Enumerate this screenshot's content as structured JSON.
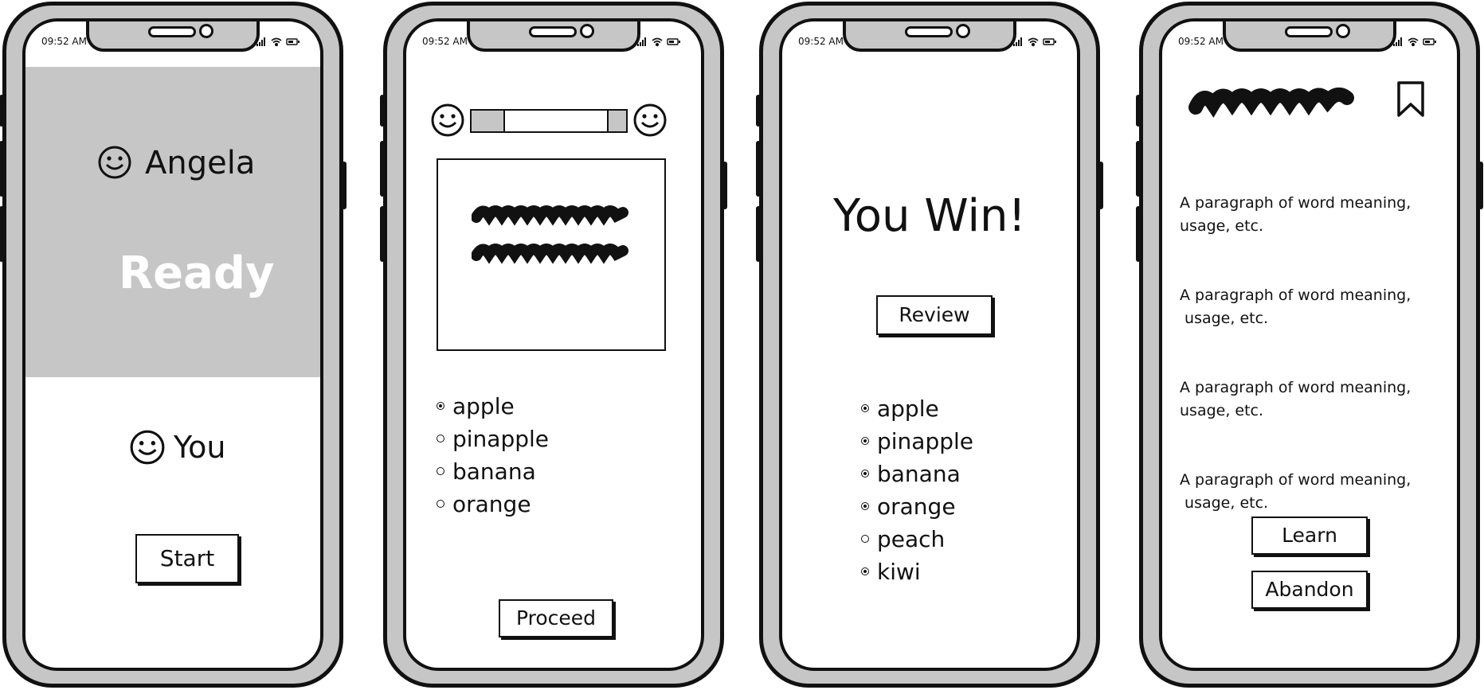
{
  "status_bar": {
    "time": "09:52 AM"
  },
  "screen1": {
    "opponent_name": "Angela",
    "ready_label": "Ready",
    "player_name": "You",
    "start_label": "Start"
  },
  "screen2": {
    "options": [
      {
        "label": "apple",
        "selected": true
      },
      {
        "label": "pinapple",
        "selected": false
      },
      {
        "label": "banana",
        "selected": false
      },
      {
        "label": "orange",
        "selected": false
      }
    ],
    "proceed_label": "Proceed"
  },
  "screen3": {
    "result_title": "You Win!",
    "review_label": "Review",
    "words": [
      {
        "label": "apple",
        "selected": true
      },
      {
        "label": "pinapple",
        "selected": true
      },
      {
        "label": "banana",
        "selected": true
      },
      {
        "label": "orange",
        "selected": true
      },
      {
        "label": "peach",
        "selected": false
      },
      {
        "label": "kiwi",
        "selected": true
      }
    ]
  },
  "screen4": {
    "paragraphs": [
      {
        "line1": "A paragraph of word meaning,",
        "line2": "usage, etc."
      },
      {
        "line1": "A paragraph of word meaning,",
        "line2": " usage, etc."
      },
      {
        "line1": "A paragraph of word meaning,",
        "line2": "usage, etc."
      },
      {
        "line1": "A paragraph of word meaning,",
        "line2": " usage, etc."
      }
    ],
    "learn_label": "Learn",
    "abandon_label": "Abandon"
  },
  "icons": {
    "smiley": "smiley-icon",
    "bookmark": "bookmark-icon",
    "signal": "signal-icon",
    "wifi": "wifi-icon",
    "battery": "battery-icon"
  },
  "colors": {
    "ready_panel": "#c6c6c6",
    "ready_text": "#ffffff",
    "frame": "#c6c6c6",
    "ink": "#111111"
  }
}
